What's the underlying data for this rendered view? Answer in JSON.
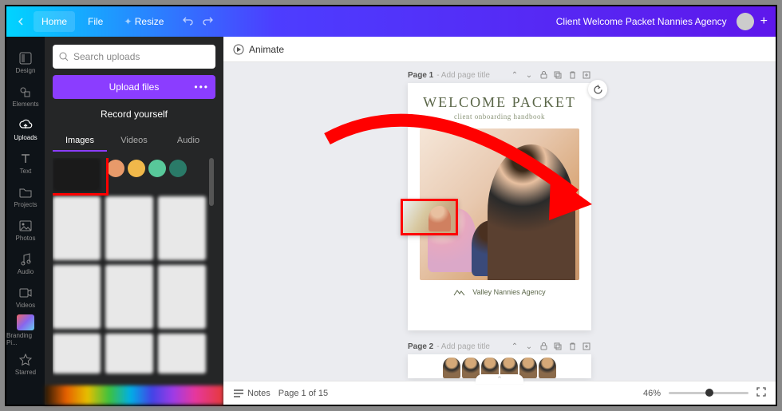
{
  "topbar": {
    "home": "Home",
    "file": "File",
    "resize": "Resize",
    "title": "Client Welcome Packet Nannies Agency"
  },
  "rail": {
    "items": [
      {
        "label": "Design"
      },
      {
        "label": "Elements"
      },
      {
        "label": "Uploads"
      },
      {
        "label": "Text"
      },
      {
        "label": "Projects"
      },
      {
        "label": "Photos"
      },
      {
        "label": "Audio"
      },
      {
        "label": "Videos"
      },
      {
        "label": "Branding Pi..."
      },
      {
        "label": "Starred"
      }
    ],
    "active_index": 2
  },
  "panel": {
    "search_placeholder": "Search uploads",
    "upload_button": "Upload files",
    "record_button": "Record yourself",
    "tabs": [
      "Images",
      "Videos",
      "Audio"
    ],
    "active_tab_index": 0,
    "swatches": [
      "#e89a6a",
      "#f0b84a",
      "#58c89a",
      "#2a7a68"
    ]
  },
  "canvas": {
    "animate_label": "Animate",
    "page1": {
      "label_prefix": "Page 1",
      "placeholder": "- Add page title",
      "doc_title": "WELCOME PACKET",
      "doc_subtitle": "client onboarding handbook",
      "footer_text": "Valley Nannies Agency"
    },
    "page2": {
      "label_prefix": "Page 2",
      "placeholder": "- Add page title"
    }
  },
  "status": {
    "notes": "Notes",
    "pager": "Page 1 of 15",
    "zoom": "46%"
  }
}
